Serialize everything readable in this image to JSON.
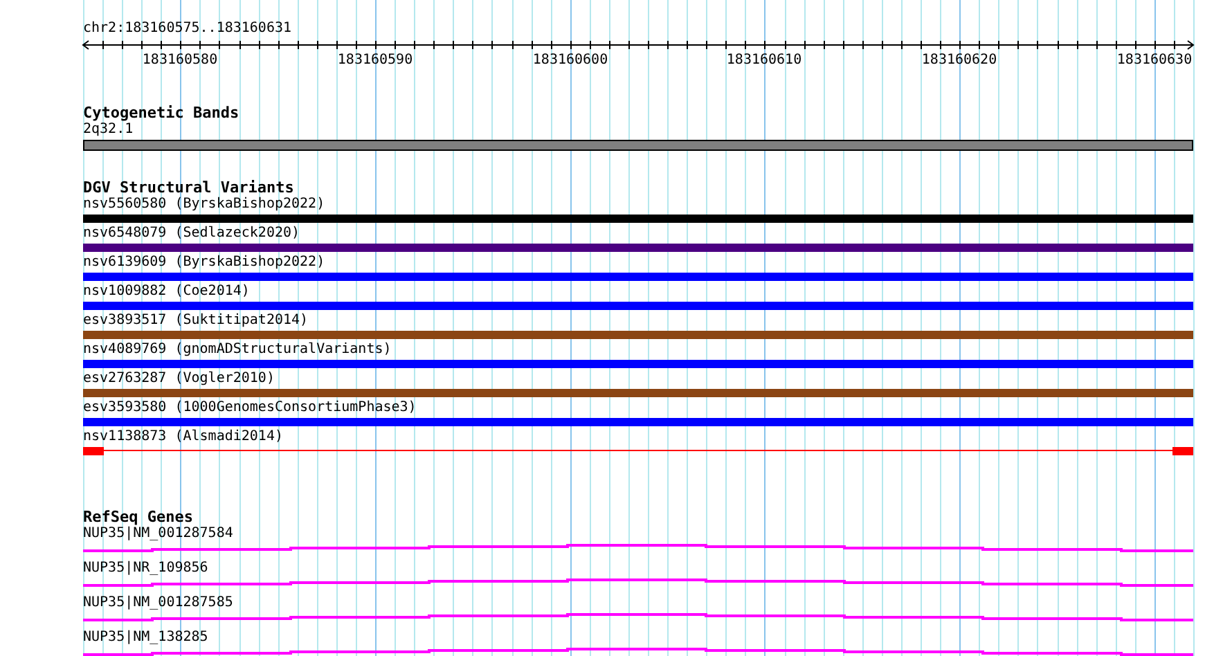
{
  "ruler": {
    "range": "chr2:183160575..183160631",
    "labels": [
      "183160580",
      "183160590",
      "183160600",
      "183160610",
      "183160620",
      "183160630"
    ]
  },
  "tracks": [
    {
      "kind": "cytoband",
      "title": "Cytogenetic Bands",
      "features": [
        {
          "label": "2q32.1"
        }
      ]
    },
    {
      "kind": "variants",
      "title": "DGV Structural Variants",
      "features": [
        {
          "label": "nsv5560580 (ByrskaBishop2022)",
          "color": "#000000",
          "kind": "solid"
        },
        {
          "label": "nsv6548079 (Sedlazeck2020)",
          "color": "#4b0082",
          "kind": "solid"
        },
        {
          "label": "nsv6139609 (ByrskaBishop2022)",
          "color": "#0000ff",
          "kind": "solid"
        },
        {
          "label": "nsv1009882 (Coe2014)",
          "color": "#0000ff",
          "kind": "solid"
        },
        {
          "label": "esv3893517 (Suktitipat2014)",
          "color": "#8b4513",
          "kind": "solid"
        },
        {
          "label": "nsv4089769 (gnomADStructuralVariants)",
          "color": "#0000ff",
          "kind": "solid"
        },
        {
          "label": "esv2763287 (Vogler2010)",
          "color": "#8b4513",
          "kind": "solid"
        },
        {
          "label": "esv3593580 (1000GenomesConsortiumPhase3)",
          "color": "#0000ff",
          "kind": "solid"
        },
        {
          "label": "nsv1138873 (Alsmadi2014)",
          "color": "#ff0000",
          "kind": "ends"
        }
      ]
    },
    {
      "kind": "genes",
      "title": "RefSeq Genes",
      "features": [
        {
          "label": "NUP35|NM_001287584"
        },
        {
          "label": "NUP35|NR_109856"
        },
        {
          "label": "NUP35|NM_001287585"
        },
        {
          "label": "NUP35|NM_138285"
        }
      ]
    }
  ]
}
